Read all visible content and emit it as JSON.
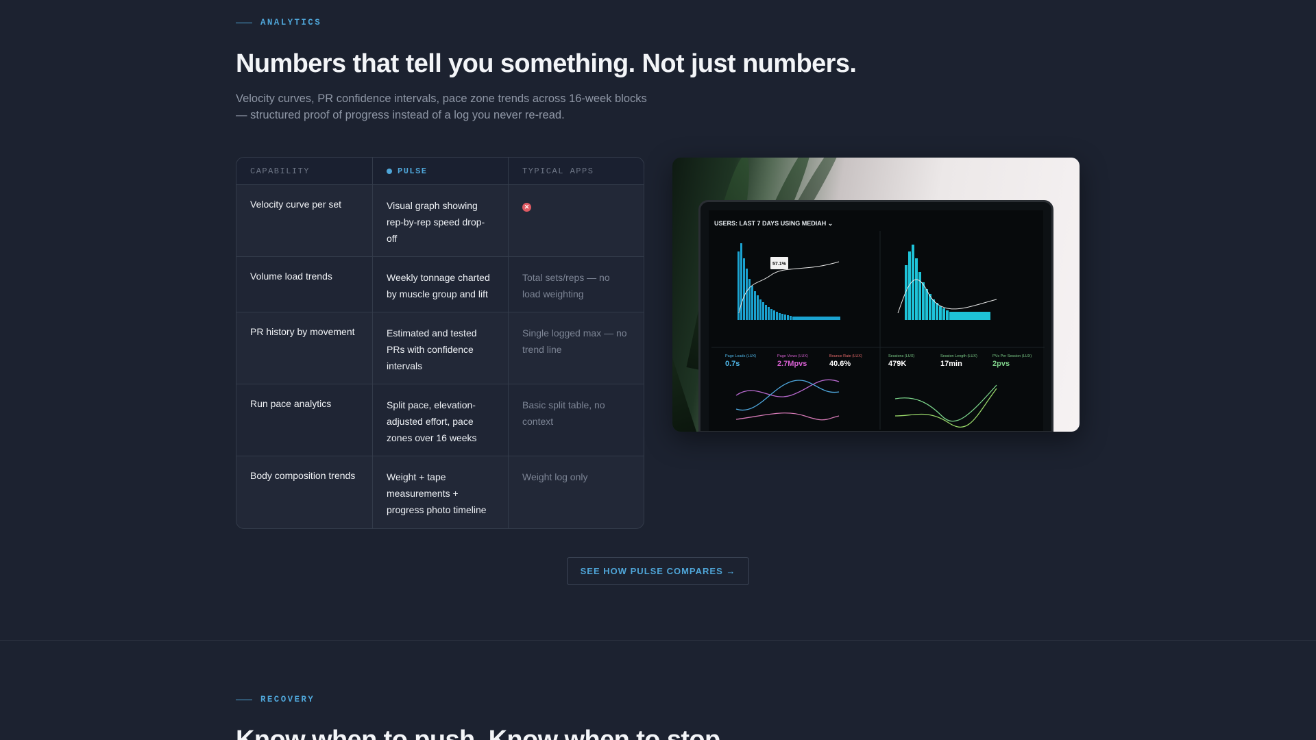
{
  "analytics": {
    "eyebrow": "ANALYTICS",
    "headline": "Numbers that tell you something. Not just numbers.",
    "subtitle": "Velocity curves, PR confidence intervals, pace zone trends across 16-week blocks — structured proof of progress instead of a log you never re-read."
  },
  "table": {
    "headers": {
      "capability": "CAPABILITY",
      "pulse": "PULSE",
      "typical": "TYPICAL APPS"
    },
    "rows": [
      {
        "capability": "Velocity curve per set",
        "pulse": "Visual graph showing rep-by-rep speed drop-off",
        "typical": "",
        "typical_icon": "x-circle-icon"
      },
      {
        "capability": "Volume load trends",
        "pulse": "Weekly tonnage charted by muscle group and lift",
        "typical": "Total sets/reps — no load weighting"
      },
      {
        "capability": "PR history by movement",
        "pulse": "Estimated and tested PRs with confidence intervals",
        "typical": "Single logged max — no trend line"
      },
      {
        "capability": "Run pace analytics",
        "pulse": "Split pace, elevation-adjusted effort, pace zones over 16 weeks",
        "typical": "Basic split table, no context"
      },
      {
        "capability": "Body composition trends",
        "pulse": "Weight + tape measurements + progress photo timeline",
        "typical": "Weight log only"
      }
    ]
  },
  "photo": {
    "screen_title": "USERS: LAST 7 DAYS USING MEDIAH",
    "tooltip": "57.1%",
    "kpis": [
      {
        "label": "Page Loads (LUX)",
        "value": "0.7s",
        "color": "#4fb7e8"
      },
      {
        "label": "Page Views (LUX)",
        "value": "2.7Mpvs",
        "color": "#d55fd0"
      },
      {
        "label": "Bounce Rate (LUX)",
        "value": "40.6%",
        "color": "#ffffff"
      },
      {
        "label": "Sessions (LUX)",
        "value": "479K",
        "color": "#ffffff"
      },
      {
        "label": "Session Length (LUX)",
        "value": "17min",
        "color": "#ffffff"
      },
      {
        "label": "PVs Per Session (LUX)",
        "value": "2pvs",
        "color": "#7ed08a"
      }
    ]
  },
  "cta": {
    "label": "SEE HOW PULSE COMPARES →"
  },
  "recovery": {
    "eyebrow": "RECOVERY",
    "headline": "Know when to push. Know when to stop."
  },
  "colors": {
    "accent": "#4fa6d9",
    "background": "#1c2230",
    "negative": "#e05a63"
  }
}
